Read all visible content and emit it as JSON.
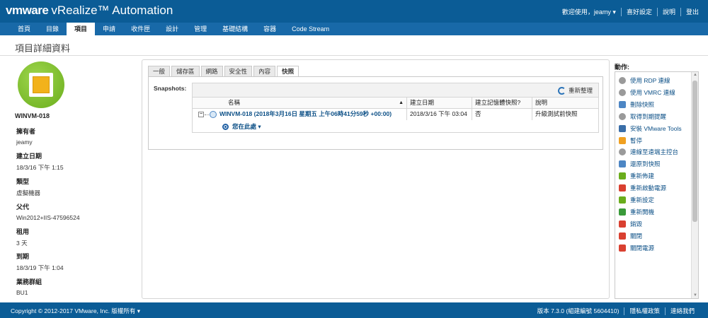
{
  "header": {
    "brand_vm": "vm",
    "brand_ware": "ware",
    "product": "vRealize™ Automation",
    "welcome": "歡迎使用，jeamy ▾",
    "preferences": "喜好設定",
    "help": "說明",
    "logout": "登出"
  },
  "nav": {
    "tabs": [
      {
        "label": "首頁",
        "active": false
      },
      {
        "label": "目錄",
        "active": false
      },
      {
        "label": "項目",
        "active": true
      },
      {
        "label": "申請",
        "active": false
      },
      {
        "label": "收件匣",
        "active": false
      },
      {
        "label": "設計",
        "active": false
      },
      {
        "label": "管理",
        "active": false
      },
      {
        "label": "基礎結構",
        "active": false
      },
      {
        "label": "容器",
        "active": false
      },
      {
        "label": "Code Stream",
        "active": false
      }
    ]
  },
  "page": {
    "title": "項目詳細資料"
  },
  "vm": {
    "name": "WINVM-018",
    "properties": [
      {
        "key": "擁有者",
        "value": "jeamy"
      },
      {
        "key": "建立日期",
        "value": "18/3/16 下午 1:15"
      },
      {
        "key": "類型",
        "value": "虛擬機器"
      },
      {
        "key": "父代",
        "value": "Win2012+IIS-47596524"
      },
      {
        "key": "租用",
        "value": "3 天"
      },
      {
        "key": "到期",
        "value": "18/3/19 下午 1:04"
      },
      {
        "key": "業務群組",
        "value": "BU1"
      }
    ]
  },
  "detail_tabs": [
    {
      "label": "一般",
      "active": false
    },
    {
      "label": "儲存區",
      "active": false
    },
    {
      "label": "網路",
      "active": false
    },
    {
      "label": "安全性",
      "active": false
    },
    {
      "label": "內容",
      "active": false
    },
    {
      "label": "快照",
      "active": true
    }
  ],
  "snapshots": {
    "label": "Snapshots:",
    "refresh_label": "重新整理",
    "columns": [
      "名稱",
      "建立日期",
      "建立記憶體快照?",
      "說明"
    ],
    "sort_indicator": "▲",
    "tree_toggle": "−",
    "rows": [
      {
        "name": "WINVM-018 (2018年3月16日 星期五 上午06時41分59秒 +00:00)",
        "created": "2018/3/16 下午 03:04",
        "memory": "否",
        "description": "升級測試前快照"
      }
    ],
    "you_are_here": "您在此處 ▾"
  },
  "actions": {
    "title": "動作:",
    "items": [
      {
        "label": "使用 RDP 連線",
        "icon": "gear-icon",
        "color": "#9a9a9a"
      },
      {
        "label": "使用 VMRC 連線",
        "icon": "gear-icon",
        "color": "#9a9a9a"
      },
      {
        "label": "刪除快照",
        "icon": "delete-snapshot-icon",
        "color": "#4d86c4"
      },
      {
        "label": "取得到期提醒",
        "icon": "gear-icon",
        "color": "#9a9a9a"
      },
      {
        "label": "安裝 VMware Tools",
        "icon": "tools-icon",
        "color": "#3a6ea8"
      },
      {
        "label": "暫停",
        "icon": "pause-icon",
        "color": "#f0a020"
      },
      {
        "label": "連線至遠端主控台",
        "icon": "gear-icon",
        "color": "#9a9a9a"
      },
      {
        "label": "還原到快照",
        "icon": "revert-snapshot-icon",
        "color": "#4d86c4"
      },
      {
        "label": "重新佈建",
        "icon": "rebuild-icon",
        "color": "#6aad1c"
      },
      {
        "label": "重新啟動電源",
        "icon": "power-cycle-icon",
        "color": "#d94030"
      },
      {
        "label": "重新設定",
        "icon": "reconfigure-icon",
        "color": "#6aad1c"
      },
      {
        "label": "重新開機",
        "icon": "reboot-icon",
        "color": "#3a9a3a"
      },
      {
        "label": "銷毀",
        "icon": "destroy-icon",
        "color": "#d94030"
      },
      {
        "label": "關閉",
        "icon": "shutdown-icon",
        "color": "#d94030"
      },
      {
        "label": "關閉電源",
        "icon": "power-off-icon",
        "color": "#d94030"
      }
    ]
  },
  "footer": {
    "copyright": "Copyright © 2012-2017 VMware, Inc. 版權所有 ▾",
    "version": "版本 7.3.0 (組建編號 5604410)",
    "privacy": "隱私權政策",
    "contact": "連絡我們"
  }
}
